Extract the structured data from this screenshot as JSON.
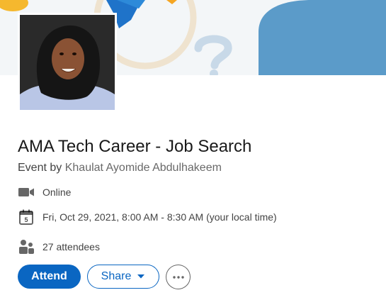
{
  "event": {
    "title": "AMA Tech Career - Job Search",
    "organizer_prefix": "Event by",
    "organizer_name": "Khaulat Ayomide Abdulhakeem"
  },
  "details": {
    "location": {
      "text": "Online",
      "icon": "video-camera-icon"
    },
    "datetime": {
      "text": "Fri, Oct 29, 2021, 8:00 AM - 8:30 AM (your local time)",
      "icon": "calendar-icon",
      "icon_label": "5"
    },
    "attendees": {
      "text": "27 attendees",
      "icon": "people-icon"
    }
  },
  "actions": {
    "attend_label": "Attend",
    "share_label": "Share",
    "more_icon": "ellipsis-icon"
  },
  "colors": {
    "primary": "#0a66c2",
    "banner_blue": "#5b9bc9",
    "banner_orange": "#f5a623"
  }
}
